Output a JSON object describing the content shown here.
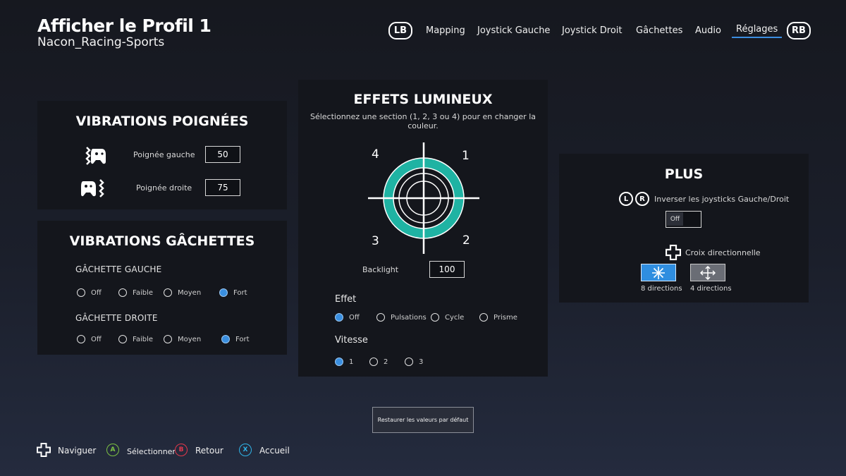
{
  "header": {
    "title": "Afficher le Profil 1",
    "subtitle": "Nacon_Racing-Sports",
    "lb": "LB",
    "rb": "RB",
    "tabs": [
      "Mapping",
      "Joystick Gauche",
      "Joystick Droit",
      "Gâchettes",
      "Audio",
      "Réglages"
    ],
    "active_tab": "Réglages"
  },
  "vibrations_poignees": {
    "title": "VIBRATIONS POIGNÉES",
    "left_label": "Poignée gauche",
    "left_value": "50",
    "right_label": "Poignée droite",
    "right_value": "75"
  },
  "vibrations_gachettes": {
    "title": "VIBRATIONS GÂCHETTES",
    "left_label": "GÂCHETTE GAUCHE",
    "right_label": "GÂCHETTE DROITE",
    "options": [
      "Off",
      "Faible",
      "Moyen",
      "Fort"
    ],
    "left_selected": "Fort",
    "right_selected": "Fort"
  },
  "effets_lumineux": {
    "title": "EFFETS LUMINEUX",
    "instruction": "Sélectionnez une section (1, 2, 3 ou 4) pour en changer la couleur.",
    "quadrants": [
      "4",
      "1",
      "3",
      "2"
    ],
    "ring_color": "#1fb3a3",
    "backlight_label": "Backlight",
    "backlight_value": "100",
    "effet_label": "Effet",
    "effet_options": [
      "Off",
      "Pulsations",
      "Cycle",
      "Prisme"
    ],
    "effet_selected": "Off",
    "vitesse_label": "Vitesse",
    "vitesse_options": [
      "1",
      "2",
      "3"
    ],
    "vitesse_selected": "1"
  },
  "plus": {
    "title": "PLUS",
    "l": "L",
    "r": "R",
    "invert_label": "Inverser les joysticks Gauche/Droit",
    "invert_value": "Off",
    "dpad_label": "Croix directionnelle",
    "dir8_label": "8 directions",
    "dir4_label": "4 directions",
    "selected_color": "#2f8ee0"
  },
  "restore_label": "Restaurer les valeurs par défaut",
  "footer": {
    "navigate": "Naviguer",
    "a": "A",
    "select": "Sélectionner",
    "b": "B",
    "back": "Retour",
    "x": "X",
    "home": "Accueil"
  }
}
